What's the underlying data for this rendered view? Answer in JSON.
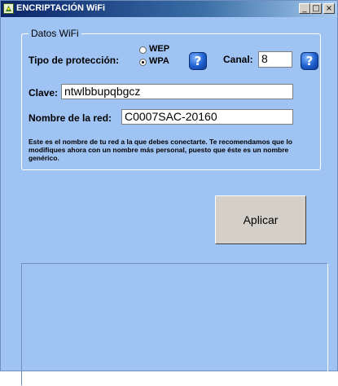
{
  "window": {
    "title": "ENCRIPTACIÓN WiFi"
  },
  "controls": {
    "minimize": "_",
    "maximize": "□",
    "close": "×"
  },
  "group": {
    "legend": "Datos WiFi",
    "protection_label": "Tipo de protección:",
    "options": [
      {
        "label": "WEP",
        "selected": false
      },
      {
        "label": "WPA",
        "selected": true
      }
    ],
    "channel_label": "Canal:",
    "channel_value": "8",
    "key_label": "Clave:",
    "key_value": "ntwlbbupqbgcz",
    "ssid_label": "Nombre de la red:",
    "ssid_value": "C0007SAC-20160",
    "note": "Este es el nombre de tu red a la que debes conectarte. Te recomendamos que lo modifiques ahora con un nombre más personal, puesto que éste es un nombre genérico."
  },
  "apply_label": "Aplicar",
  "help_glyph": "?",
  "icons": [
    "app-icon",
    "help-icon"
  ]
}
